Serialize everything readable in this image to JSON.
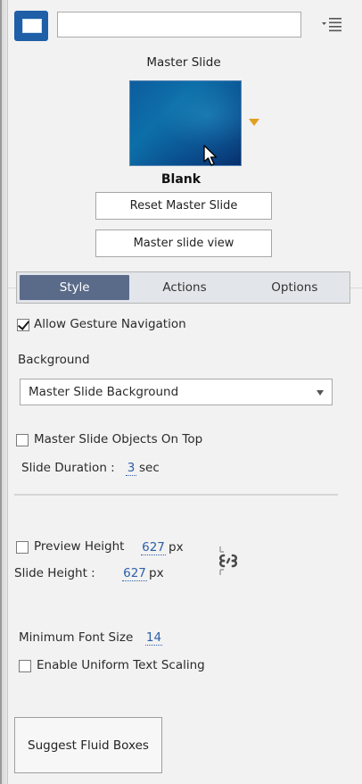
{
  "header": {
    "name_value": "",
    "menu_icon": "list-menu-icon",
    "slide_icon": "slide-layout-icon"
  },
  "master": {
    "section_label": "Master Slide",
    "thumbnail_name": "Blank",
    "reset_button": "Reset Master Slide",
    "view_button": "Master slide view",
    "accent_color": "#e0a020"
  },
  "tabs": [
    {
      "label": "Style",
      "active": true
    },
    {
      "label": "Actions",
      "active": false
    },
    {
      "label": "Options",
      "active": false
    }
  ],
  "style": {
    "gesture_nav": {
      "label": "Allow Gesture Navigation",
      "checked": true
    },
    "background": {
      "label": "Background",
      "selected": "Master Slide Background"
    },
    "objects_on_top": {
      "label": "Master Slide Objects On Top",
      "checked": false
    },
    "duration": {
      "label": "Slide Duration :",
      "value": "3",
      "unit": "sec"
    },
    "preview_height": {
      "label": "Preview Height",
      "checked": false,
      "value": "627",
      "unit": "px"
    },
    "slide_height": {
      "label": "Slide Height :",
      "value": "627",
      "unit": "px"
    },
    "min_font": {
      "label": "Minimum Font Size",
      "value": "14"
    },
    "uniform_scaling": {
      "label": "Enable Uniform Text Scaling",
      "checked": false
    },
    "suggest_button": "Suggest Fluid Boxes"
  },
  "colors": {
    "active_tab": "#5a6a89",
    "primary_icon": "#1f5fa8",
    "value_link": "#2b5fa8"
  }
}
